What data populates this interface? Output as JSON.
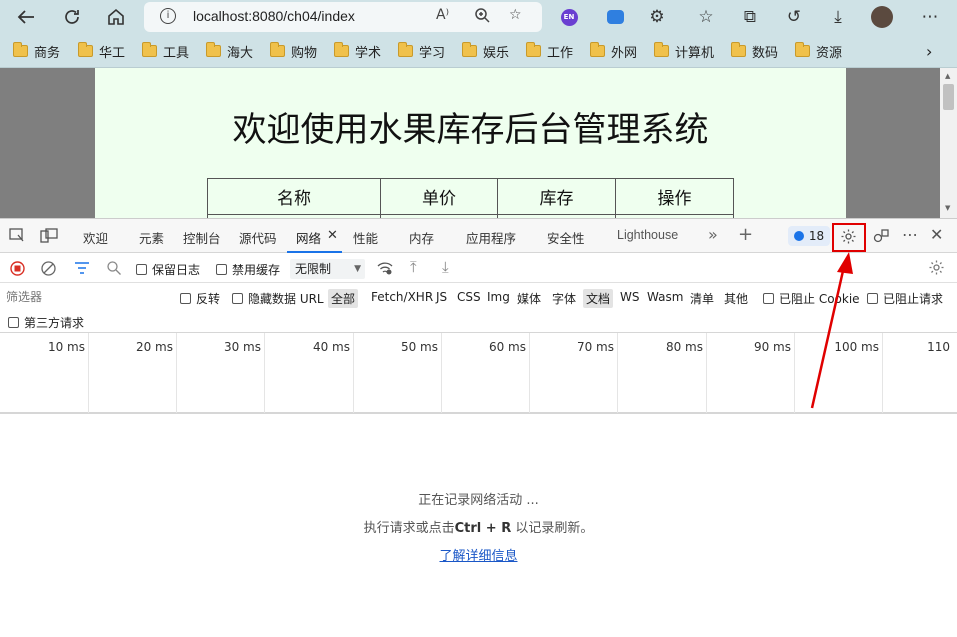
{
  "browser": {
    "url": "localhost:8080/ch04/index",
    "profile_badge": "EN",
    "bookmarks": [
      "商务",
      "华工",
      "工具",
      "海大",
      "购物",
      "学术",
      "学习",
      "娱乐",
      "工作",
      "外网",
      "计算机",
      "数码",
      "资源"
    ]
  },
  "page": {
    "title": "欢迎使用水果库存后台管理系统",
    "table_headers": [
      "名称",
      "单价",
      "库存",
      "操作"
    ]
  },
  "devtools": {
    "tabs": [
      "欢迎",
      "元素",
      "控制台",
      "源代码",
      "网络",
      "性能",
      "内存",
      "应用程序",
      "安全性",
      "Lighthouse"
    ],
    "active_tab": "网络",
    "issues_count": "18",
    "toolbar": {
      "preserve_log": "保留日志",
      "disable_cache": "禁用缓存",
      "throttle": "无限制"
    },
    "filter": {
      "placeholder": "筛选器",
      "invert": "反转",
      "hide_data_urls": "隐藏数据 URL",
      "types": [
        "全部",
        "Fetch/XHR",
        "JS",
        "CSS",
        "Img",
        "媒体",
        "字体",
        "文档",
        "WS",
        "Wasm",
        "清单",
        "其他"
      ],
      "blocked_cookies": "已阻止 Cookie",
      "blocked_requests": "已阻止请求",
      "third_party": "第三方请求"
    },
    "timeline_ticks": [
      "10 ms",
      "20 ms",
      "30 ms",
      "40 ms",
      "50 ms",
      "60 ms",
      "70 ms",
      "80 ms",
      "90 ms",
      "100 ms",
      "110"
    ],
    "empty_state": {
      "line1": "正在记录网络活动 ...",
      "line2_pre": "执行请求或点击",
      "line2_key": "Ctrl + R",
      "line2_post": "以记录刷新。",
      "learn_more": "了解详细信息"
    }
  },
  "colors": {
    "highlight": "#e00000",
    "accent": "#1a73e8",
    "page_bg": "#efffef"
  }
}
